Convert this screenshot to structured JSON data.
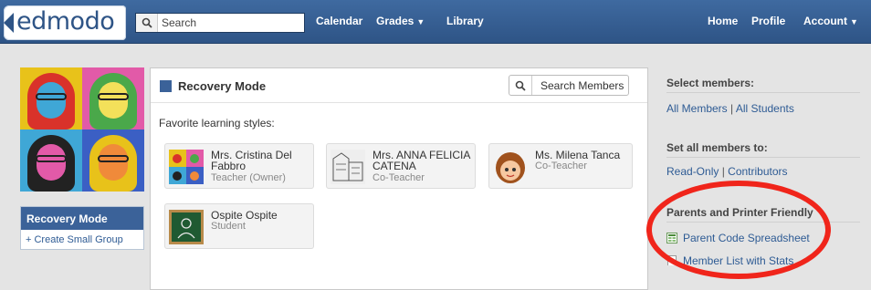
{
  "brand": {
    "logo_text": "edmodo"
  },
  "nav": {
    "search_placeholder": "Search",
    "calendar": "Calendar",
    "grades": "Grades",
    "library": "Library",
    "home": "Home",
    "profile": "Profile",
    "account": "Account"
  },
  "group": {
    "title": "Recovery Mode",
    "create_small_group": "+ Create Small Group"
  },
  "main": {
    "title": "Recovery Mode",
    "search_members": "Search Members",
    "favorite_label": "Favorite learning styles:",
    "members": [
      {
        "name_line1": "Mrs. Cristina Del",
        "name_line2": "Fabbro",
        "role": "Teacher (Owner)"
      },
      {
        "name_line1": "Mrs. ANNA FELICIA",
        "name_line2": "CATENA",
        "role": "Co-Teacher"
      },
      {
        "name_line1": "Ms. Milena Tanca",
        "name_line2": "",
        "role": "Co-Teacher"
      },
      {
        "name_line1": "Ospite Ospite",
        "name_line2": "",
        "role": "Student"
      }
    ]
  },
  "sidebar": {
    "select_members": "Select members:",
    "all_members": "All Members",
    "all_students": "All Students",
    "set_all_to": "Set all members to:",
    "read_only": "Read-Only",
    "contributors": "Contributors",
    "separator": "|",
    "parents_printer": "Parents and Printer Friendly",
    "parent_code_spreadsheet": "Parent Code Spreadsheet",
    "member_list_with_stats": "Member List with Stats"
  },
  "colors": {
    "nav_bar": "#2e5486",
    "accent_blue": "#3b6299",
    "link_blue": "#2e5b94",
    "highlight_red": "#f0251b"
  }
}
